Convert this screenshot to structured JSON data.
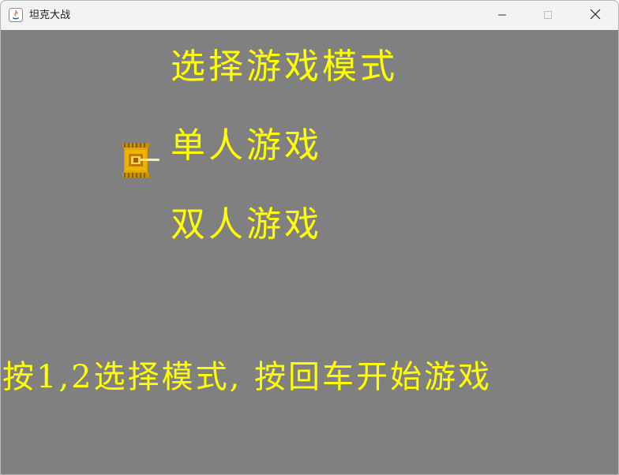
{
  "window": {
    "title": "坦克大战"
  },
  "titlebar_buttons": {
    "minimize_icon": "minimize-icon",
    "maximize_icon": "maximize-icon",
    "close_icon": "close-icon"
  },
  "menu": {
    "title": "选择游戏模式",
    "options": [
      {
        "label": "单人游戏"
      },
      {
        "label": "双人游戏"
      }
    ],
    "selected_index": 0,
    "cursor_icon": "tank-icon"
  },
  "hint": "按1,2选择模式, 按回车开始游戏",
  "colors": {
    "background": "#808080",
    "text": "#ffff00",
    "tank_body": "#d9a300"
  }
}
